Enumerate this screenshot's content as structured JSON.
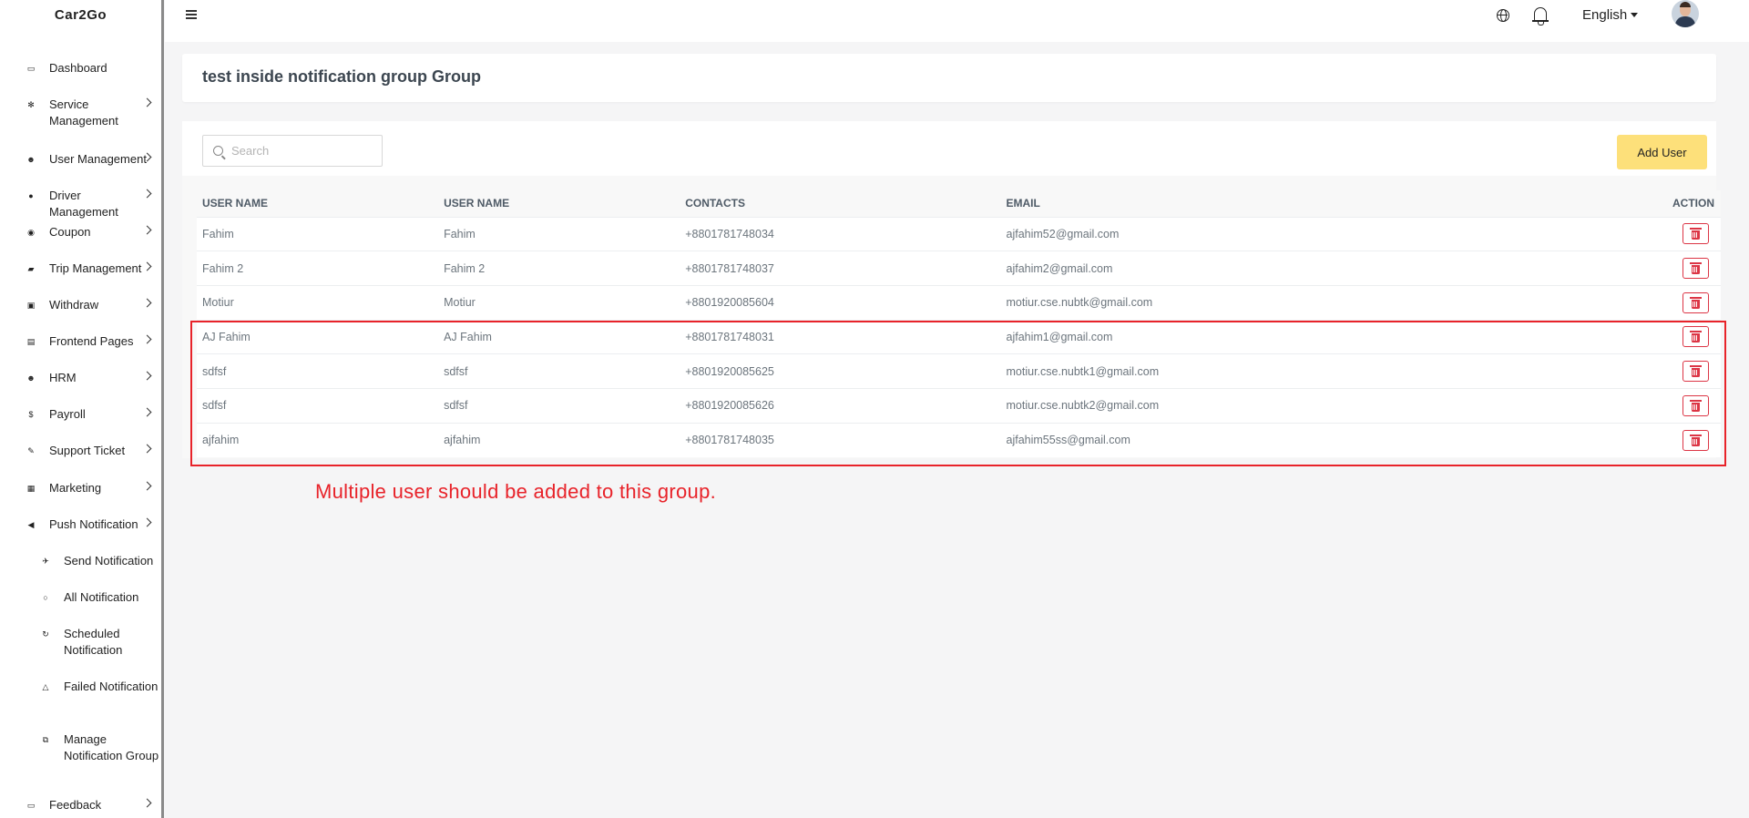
{
  "app": {
    "brand": "Car2Go"
  },
  "sidebar": {
    "items": [
      {
        "label": "Dashboard",
        "icon": "laptop-icon",
        "has_chevron": false
      },
      {
        "label": "Service Management",
        "icon": "gear-icon",
        "has_chevron": true
      },
      {
        "label": "User Management",
        "icon": "users-icon",
        "has_chevron": true
      },
      {
        "label": "Driver Management",
        "icon": "user-icon",
        "has_chevron": true
      },
      {
        "label": "Coupon",
        "icon": "coupon-icon",
        "has_chevron": true
      },
      {
        "label": "Trip Management",
        "icon": "car-icon",
        "has_chevron": true
      },
      {
        "label": "Withdraw",
        "icon": "money-icon",
        "has_chevron": true
      },
      {
        "label": "Frontend Pages",
        "icon": "page-icon",
        "has_chevron": true
      },
      {
        "label": "HRM",
        "icon": "team-icon",
        "has_chevron": true
      },
      {
        "label": "Payroll",
        "icon": "dollar-icon",
        "has_chevron": true
      },
      {
        "label": "Support Ticket",
        "icon": "wrench-icon",
        "has_chevron": true
      },
      {
        "label": "Marketing",
        "icon": "grid-icon",
        "has_chevron": true
      },
      {
        "label": "Push Notification",
        "icon": "megaphone-icon",
        "has_chevron": true
      }
    ],
    "sub_items": [
      {
        "label": "Send Notification",
        "icon": "send-icon"
      },
      {
        "label": "All Notification",
        "icon": "circle-icon"
      },
      {
        "label": "Scheduled Notification",
        "icon": "schedule-icon"
      },
      {
        "label": "Failed Notification",
        "icon": "alert-icon"
      },
      {
        "label": "Manage Notification Group",
        "icon": "external-icon"
      }
    ],
    "footer_item": {
      "label": "Feedback",
      "icon": "comment-icon"
    }
  },
  "topbar": {
    "language": "English"
  },
  "page": {
    "title": "test inside notification group Group"
  },
  "search": {
    "placeholder": "Search"
  },
  "actions": {
    "add_user_label": "Add User"
  },
  "table": {
    "headers": [
      "USER NAME",
      "USER NAME",
      "CONTACTS",
      "EMAIL",
      "ACTION"
    ],
    "rows": [
      {
        "name": "Fahim",
        "user_name": "Fahim",
        "contact": "+8801781748034",
        "email": "ajfahim52@gmail.com"
      },
      {
        "name": "Fahim 2",
        "user_name": "Fahim 2",
        "contact": "+8801781748037",
        "email": "ajfahim2@gmail.com"
      },
      {
        "name": "Motiur",
        "user_name": "Motiur",
        "contact": "+8801920085604",
        "email": "motiur.cse.nubtk@gmail.com"
      },
      {
        "name": "AJ Fahim",
        "user_name": "AJ Fahim",
        "contact": "+8801781748031",
        "email": "ajfahim1@gmail.com"
      },
      {
        "name": "sdfsf",
        "user_name": "sdfsf",
        "contact": "+8801920085625",
        "email": "motiur.cse.nubtk1@gmail.com"
      },
      {
        "name": "sdfsf",
        "user_name": "sdfsf",
        "contact": "+8801920085626",
        "email": "motiur.cse.nubtk2@gmail.com"
      },
      {
        "name": "ajfahim",
        "user_name": "ajfahim",
        "contact": "+8801781748035",
        "email": "ajfahim55ss@gmail.com"
      }
    ]
  },
  "annotation": {
    "text": "Multiple user should be added to this group.",
    "color": "#e8232a"
  },
  "colors": {
    "accent_button": "#fde07a",
    "danger": "#dc3545"
  }
}
